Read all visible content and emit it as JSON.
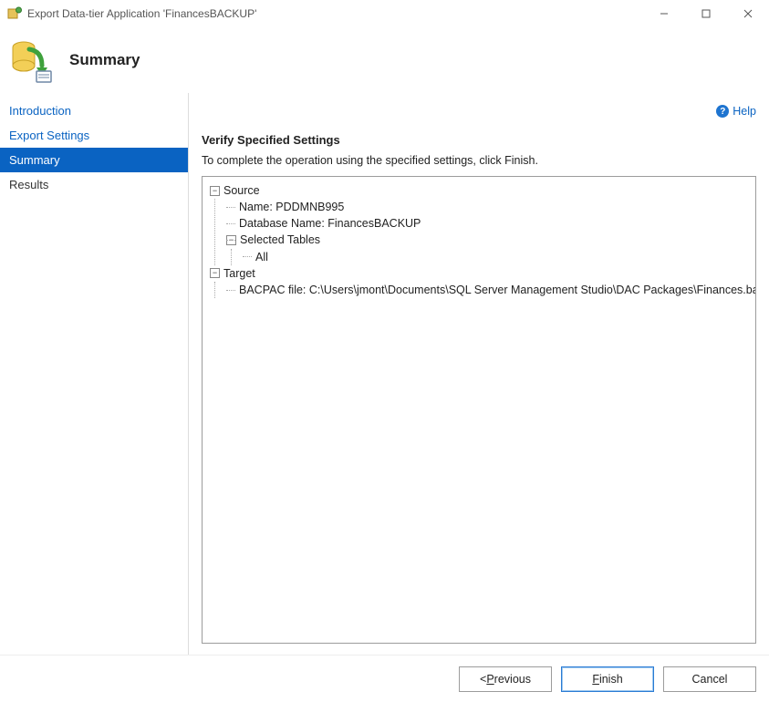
{
  "window": {
    "title": "Export Data-tier Application 'FinancesBACKUP'"
  },
  "header": {
    "title": "Summary"
  },
  "sidebar": {
    "items": [
      {
        "label": "Introduction",
        "name": "nav-introduction",
        "link": true,
        "selected": false
      },
      {
        "label": "Export Settings",
        "name": "nav-export-settings",
        "link": true,
        "selected": false
      },
      {
        "label": "Summary",
        "name": "nav-summary",
        "link": false,
        "selected": true
      },
      {
        "label": "Results",
        "name": "nav-results",
        "link": false,
        "selected": false
      }
    ]
  },
  "content": {
    "help_label": "Help",
    "section_heading": "Verify Specified Settings",
    "instruction": "To complete the operation using the specified settings, click Finish.",
    "tree": {
      "source_label": "Source",
      "source_name": "Name: PDDMNB995",
      "source_db": "Database Name: FinancesBACKUP",
      "selected_tables_label": "Selected Tables",
      "selected_tables_value": "All",
      "target_label": "Target",
      "target_file": "BACPAC file: C:\\Users\\jmont\\Documents\\SQL Server Management Studio\\DAC Packages\\Finances.bacpac"
    }
  },
  "footer": {
    "previous_prefix": "< ",
    "previous_letter": "P",
    "previous_rest": "revious",
    "finish_letter": "F",
    "finish_rest": "inish",
    "cancel_label": "Cancel"
  }
}
